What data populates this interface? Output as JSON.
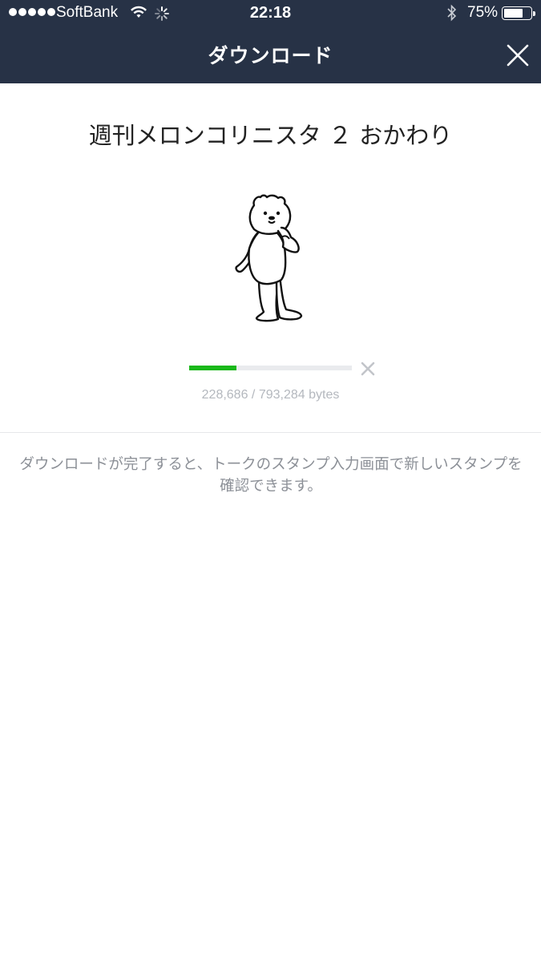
{
  "status_bar": {
    "carrier": "SoftBank",
    "time": "22:18",
    "battery_percent": "75%",
    "battery_level": 0.75,
    "signal_bars": 5
  },
  "nav": {
    "title": "ダウンロード",
    "close_icon": "close-icon"
  },
  "sticker": {
    "title": "週刊メロンコリニスタ ２ おかわり",
    "image_icon": "bear-sticker"
  },
  "download": {
    "downloaded_bytes": 228686,
    "total_bytes": 793284,
    "bytes_text": "228,686 / 793,284 bytes",
    "progress_color": "#1ab81a",
    "cancel_icon": "cancel-icon"
  },
  "notice": {
    "line1": "ダウンロードが完了すると、トークのスタンプ入力画面で新しいスタンプを確認できます。"
  },
  "colors": {
    "header": "#273246",
    "accent": "#1ab81a"
  }
}
